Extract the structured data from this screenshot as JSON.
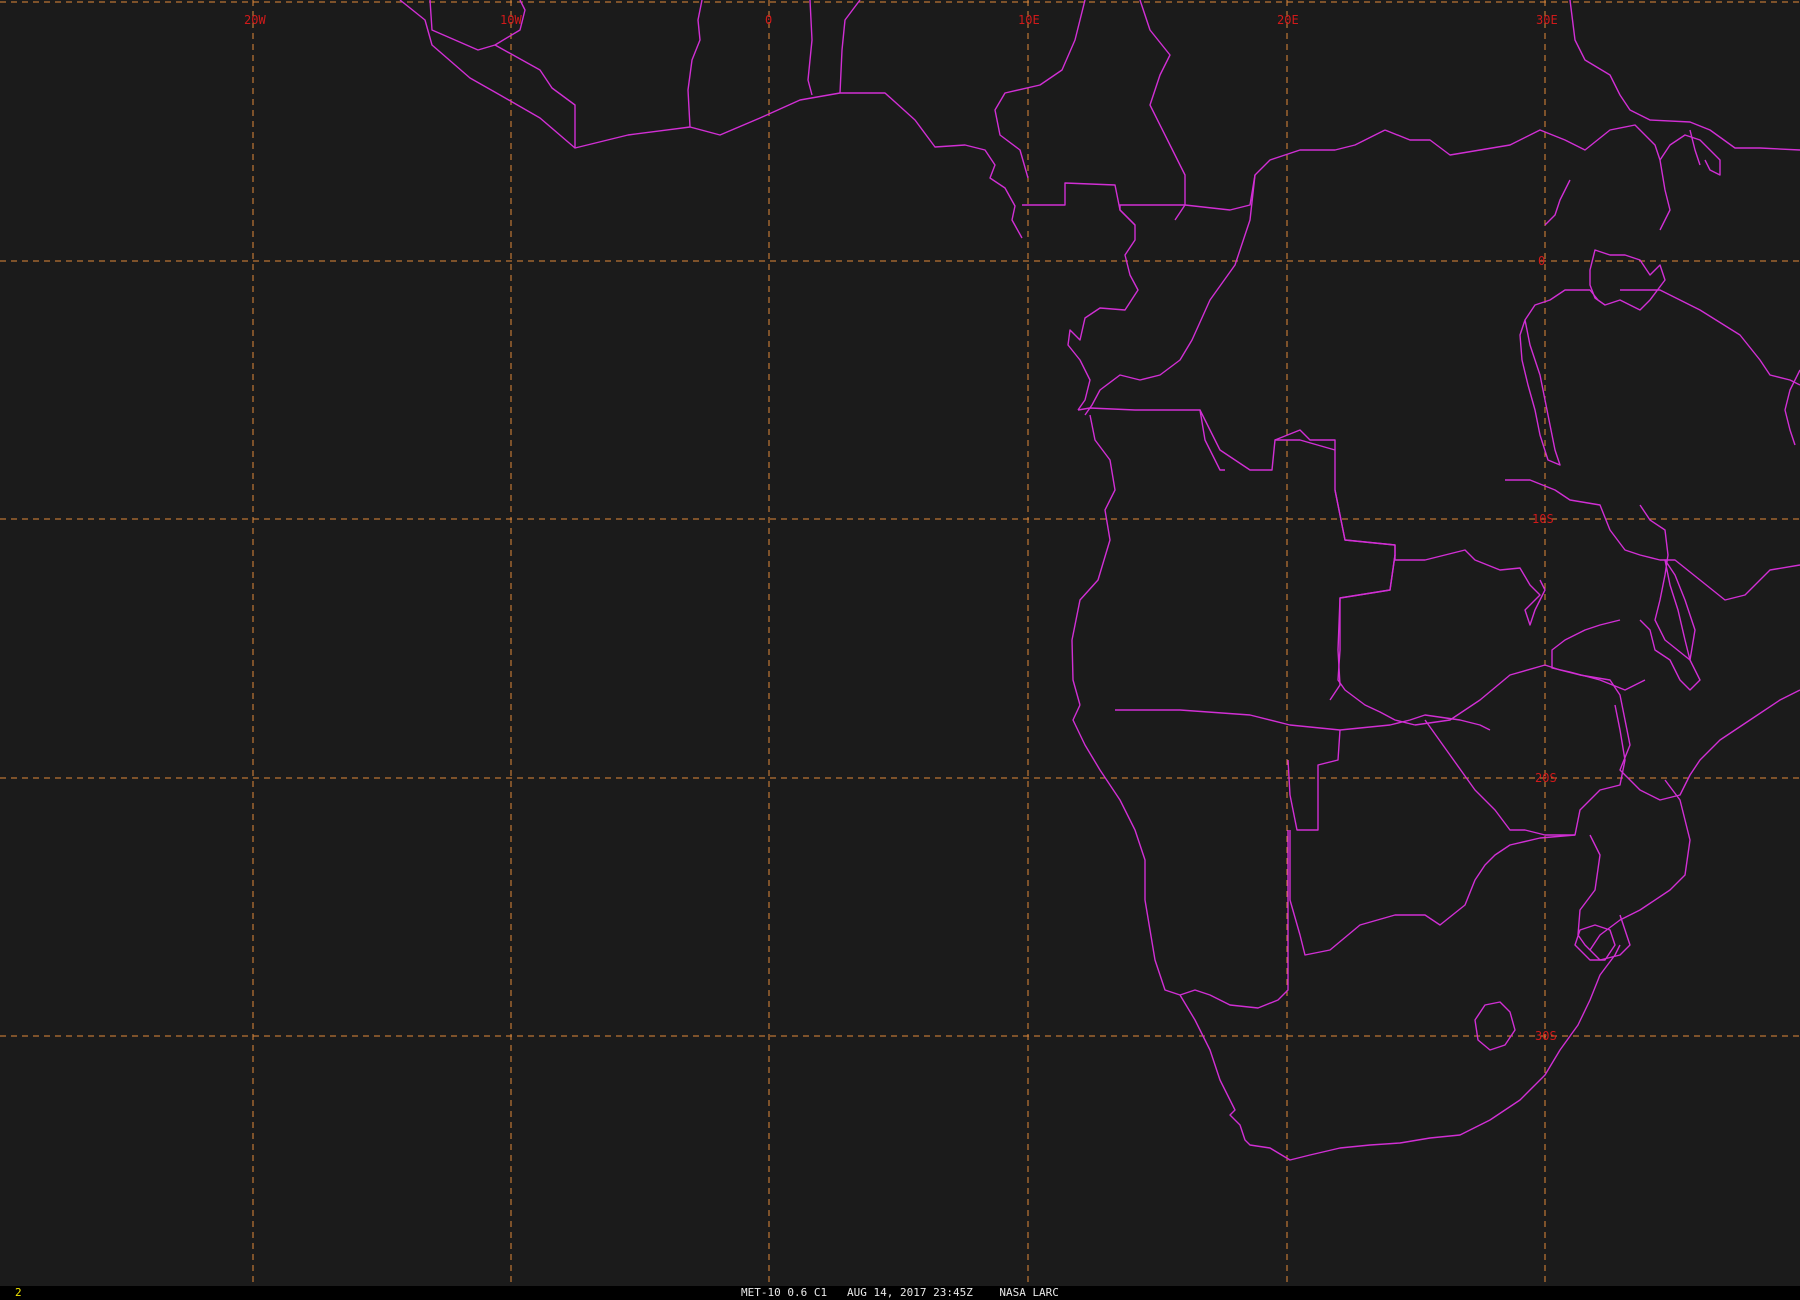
{
  "map": {
    "lon_labels": [
      "20W",
      "10W",
      "0",
      "10E",
      "20E",
      "30E"
    ],
    "lat_labels": [
      "0",
      "10S",
      "20S",
      "30S"
    ],
    "colors": {
      "background": "#1b1b1b",
      "grid": "#e08a3a",
      "borders": "#d12fd4",
      "labels": "#d11a1a"
    }
  },
  "status_bar": {
    "frame_number": "2",
    "caption": "MET-10 0.6 C1   AUG 14, 2017 23:45Z    NASA LARC"
  }
}
